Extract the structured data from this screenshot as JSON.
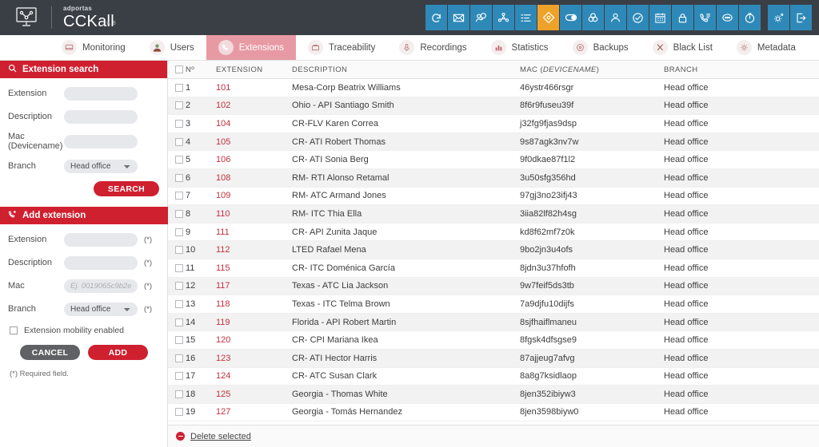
{
  "brand": {
    "sup": "adportas",
    "name": "CCKall",
    "version": "v. 8"
  },
  "toolbar": {
    "icons": [
      {
        "name": "refresh-icon",
        "glyph": "refresh",
        "active": false
      },
      {
        "name": "mail-icon",
        "glyph": "mail",
        "active": false
      },
      {
        "name": "user-chat-icon",
        "glyph": "userchat",
        "active": false
      },
      {
        "name": "network-icon",
        "glyph": "network",
        "active": false
      },
      {
        "name": "list-icon",
        "glyph": "list",
        "active": false
      },
      {
        "name": "diamond-icon",
        "glyph": "diamond",
        "active": true
      },
      {
        "name": "toggle-icon",
        "glyph": "toggle",
        "active": false
      },
      {
        "name": "venn-icon",
        "glyph": "venn",
        "active": false
      },
      {
        "name": "person-icon",
        "glyph": "person",
        "active": false
      },
      {
        "name": "check-circle-icon",
        "glyph": "check",
        "active": false
      },
      {
        "name": "calendar-icon",
        "glyph": "calendar",
        "active": false
      },
      {
        "name": "lock-icon",
        "glyph": "lock",
        "active": false
      },
      {
        "name": "phone-list-icon",
        "glyph": "phonelist",
        "active": false
      },
      {
        "name": "chat-icon",
        "glyph": "chat",
        "active": false
      },
      {
        "name": "timer-icon",
        "glyph": "timer",
        "active": false
      },
      {
        "name": "settings-icon",
        "glyph": "gear",
        "active": false
      },
      {
        "name": "logout-icon",
        "glyph": "logout",
        "active": false
      }
    ]
  },
  "nav": {
    "tabs": [
      {
        "label": "Monitoring",
        "icon": "monitor-icon",
        "active": false
      },
      {
        "label": "Users",
        "icon": "users-icon",
        "active": false
      },
      {
        "label": "Extensions",
        "icon": "phone-icon",
        "active": true
      },
      {
        "label": "Traceability",
        "icon": "folder-icon",
        "active": false
      },
      {
        "label": "Recordings",
        "icon": "microphone-icon",
        "active": false
      },
      {
        "label": "Statistics",
        "icon": "bar-chart-icon",
        "active": false
      },
      {
        "label": "Backups",
        "icon": "disc-icon",
        "active": false
      },
      {
        "label": "Black List",
        "icon": "scissors-icon",
        "active": false
      },
      {
        "label": "Metadata",
        "icon": "gear-icon",
        "active": false
      }
    ]
  },
  "search_panel": {
    "title": "Extension search",
    "icon": "magnifier-icon",
    "fields": {
      "extension_label": "Extension",
      "extension_value": "",
      "extension_placeholder": "",
      "description_label": "Description",
      "description_value": "",
      "description_placeholder": "",
      "mac_label_line1": "Mac",
      "mac_label_line2": "(Devicename)",
      "mac_value": "",
      "mac_placeholder": "",
      "branch_label": "Branch",
      "branch_value": "Head office",
      "branch_options": [
        "Head office"
      ]
    },
    "search_button": "SEARCH"
  },
  "add_panel": {
    "title": "Add extension",
    "icon": "phone-add-icon",
    "fields": {
      "extension_label": "Extension",
      "extension_value": "",
      "extension_placeholder": "",
      "extension_required": "(*)",
      "description_label": "Description",
      "description_value": "",
      "description_placeholder": "",
      "description_required": "(*)",
      "mac_label": "Mac",
      "mac_value": "",
      "mac_placeholder": "Ej. 0019065c9b2e",
      "mac_required": "(*)",
      "branch_label": "Branch",
      "branch_value": "Head office",
      "branch_options": [
        "Head office"
      ],
      "branch_required": "(*)"
    },
    "mobility_label": "Extension mobility enabled",
    "mobility_checked": false,
    "cancel_button": "CANCEL",
    "add_button": "ADD",
    "required_note": "(*) Required field."
  },
  "table": {
    "columns": {
      "number": "Nº",
      "extension": "EXTENSION",
      "description": "DESCRIPTION",
      "mac_prefix": "MAC (",
      "mac_italic": "DEVICENAME",
      "mac_suffix": ")",
      "branch": "BRANCH"
    },
    "rows": [
      {
        "n": "1",
        "ext": "101",
        "desc": "Mesa-Corp Beatrix Williams",
        "mac": "46ystr466rsgr",
        "branch": "Head office"
      },
      {
        "n": "2",
        "ext": "102",
        "desc": "Ohio - API Santiago Smith",
        "mac": "8f6r9fuseu39f",
        "branch": "Head office"
      },
      {
        "n": "3",
        "ext": "104",
        "desc": "CR-FLV Karen Correa",
        "mac": "j32fg9fjas9dsp",
        "branch": "Head office"
      },
      {
        "n": "4",
        "ext": "105",
        "desc": "CR- ATI Robert Thomas",
        "mac": "9s87agk3nv7w",
        "branch": "Head office"
      },
      {
        "n": "5",
        "ext": "106",
        "desc": "CR- ATI Sonia Berg",
        "mac": "9f0dkae87f1l2",
        "branch": "Head office"
      },
      {
        "n": "6",
        "ext": "108",
        "desc": "RM- RTI Alonso Retamal",
        "mac": "3u50sfg356hd",
        "branch": "Head office"
      },
      {
        "n": "7",
        "ext": "109",
        "desc": "RM- ATC Armand Jones",
        "mac": "97gj3no23ifj43",
        "branch": "Head office"
      },
      {
        "n": "8",
        "ext": "110",
        "desc": "RM- ITC Thia Ella",
        "mac": "3iia82lf82h4sg",
        "branch": "Head office"
      },
      {
        "n": "9",
        "ext": "111",
        "desc": "CR- API Zunita Jaque",
        "mac": "kd8f62mf7z0k",
        "branch": "Head office"
      },
      {
        "n": "10",
        "ext": "112",
        "desc": "LTED Rafael Mena",
        "mac": "9bo2jn3u4ofs",
        "branch": "Head office"
      },
      {
        "n": "11",
        "ext": "115",
        "desc": "CR- ITC Doménica García",
        "mac": "8jdn3u37hfofh",
        "branch": "Head office"
      },
      {
        "n": "12",
        "ext": "117",
        "desc": "Texas - ATC Lia Jackson",
        "mac": "9w7feif5ds3tb",
        "branch": "Head office"
      },
      {
        "n": "13",
        "ext": "118",
        "desc": "Texas - ITC Telma Brown",
        "mac": "7a9djfu10dijfs",
        "branch": "Head office"
      },
      {
        "n": "14",
        "ext": "119",
        "desc": "Florida - API Robert Martin",
        "mac": "8sjfhaiflmaneu",
        "branch": "Head office"
      },
      {
        "n": "15",
        "ext": "120",
        "desc": "CR- CPI Mariana Ikea",
        "mac": "8fgsk4dfsgse9",
        "branch": "Head office"
      },
      {
        "n": "16",
        "ext": "123",
        "desc": "CR- ATI Hector Harris",
        "mac": "87ajjeug7afvg",
        "branch": "Head office"
      },
      {
        "n": "17",
        "ext": "124",
        "desc": "CR- ATC Susan Clark",
        "mac": "8a8g7ksidlaop",
        "branch": "Head office"
      },
      {
        "n": "18",
        "ext": "125",
        "desc": "Georgia - Thomas White",
        "mac": "8jen352ibiyw3",
        "branch": "Head office"
      },
      {
        "n": "19",
        "ext": "127",
        "desc": "Georgia - Tomás Hernandez",
        "mac": "8jen3598biyw0",
        "branch": "Head office"
      }
    ],
    "footer": {
      "delete_label": "Delete selected",
      "delete_icon": "delete-circle-icon"
    }
  },
  "colors": {
    "topbar": "#3a3f45",
    "toolbar_icon": "#2e89b8",
    "toolbar_active": "#efa22a",
    "brand_red": "#cf2030",
    "tab_active": "#e79aa4",
    "ext_text": "#c0313f"
  }
}
